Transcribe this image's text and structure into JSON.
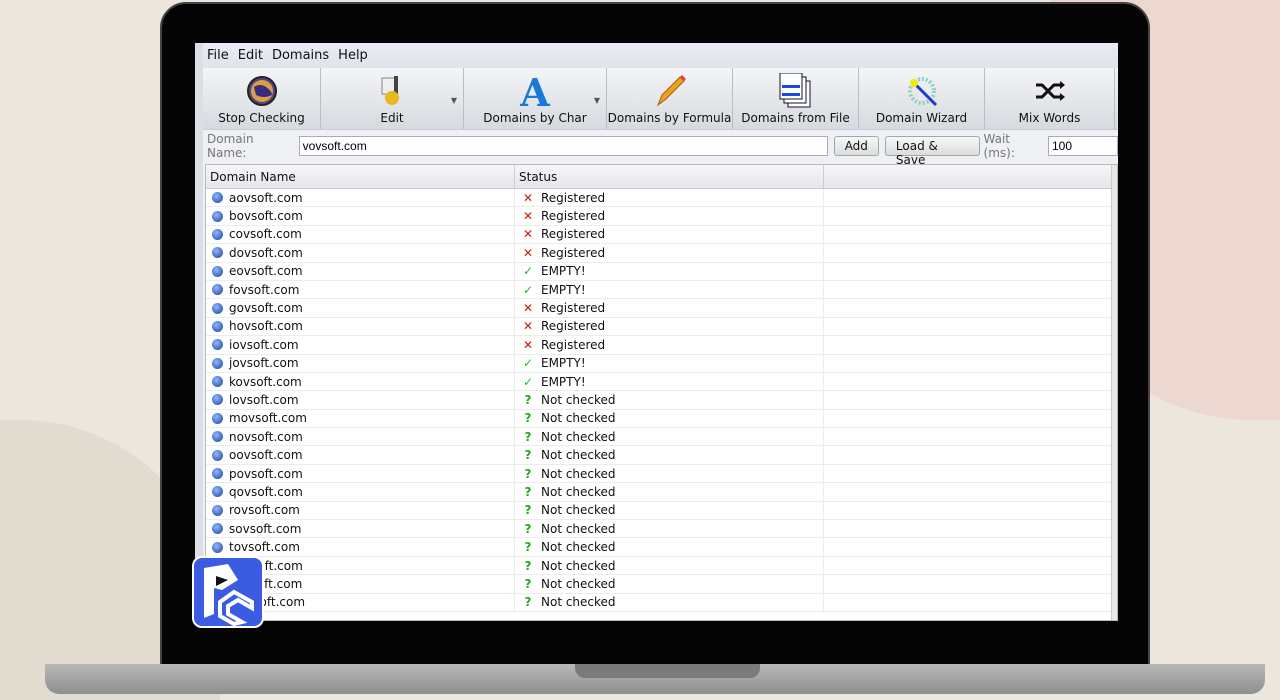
{
  "menu": [
    "File",
    "Edit",
    "Domains",
    "Help"
  ],
  "toolbar": [
    {
      "label": "Stop Checking",
      "icon": "stop-globe-icon",
      "dropdown": false,
      "width": 118
    },
    {
      "label": "Edit",
      "icon": "edit-gear-icon",
      "dropdown": true,
      "width": 143
    },
    {
      "label": "Domains by Char",
      "icon": "letter-a-icon",
      "dropdown": true,
      "width": 143
    },
    {
      "label": "Domains by Formula",
      "icon": "pencil-icon",
      "dropdown": false,
      "width": 126
    },
    {
      "label": "Domains from File",
      "icon": "documents-icon",
      "dropdown": false,
      "width": 126
    },
    {
      "label": "Domain Wizard",
      "icon": "magic-wand-icon",
      "dropdown": false,
      "width": 126
    },
    {
      "label": "Mix Words",
      "icon": "shuffle-icon",
      "dropdown": false,
      "width": 130
    }
  ],
  "input": {
    "label": "Domain Name:",
    "value": "vovsoft.com",
    "add": "Add",
    "load_save": "Load & Save",
    "wait_label": "Wait (ms):",
    "wait_value": "100"
  },
  "columns": [
    "Domain Name",
    "Status",
    ""
  ],
  "rows": [
    [
      "aovsoft.com",
      "x",
      "Registered"
    ],
    [
      "bovsoft.com",
      "x",
      "Registered"
    ],
    [
      "covsoft.com",
      "x",
      "Registered"
    ],
    [
      "dovsoft.com",
      "x",
      "Registered"
    ],
    [
      "eovsoft.com",
      "ok",
      "EMPTY!"
    ],
    [
      "fovsoft.com",
      "ok",
      "EMPTY!"
    ],
    [
      "govsoft.com",
      "x",
      "Registered"
    ],
    [
      "hovsoft.com",
      "x",
      "Registered"
    ],
    [
      "iovsoft.com",
      "x",
      "Registered"
    ],
    [
      "jovsoft.com",
      "ok",
      "EMPTY!"
    ],
    [
      "kovsoft.com",
      "ok",
      "EMPTY!"
    ],
    [
      "lovsoft.com",
      "q",
      "Not checked"
    ],
    [
      "movsoft.com",
      "q",
      "Not checked"
    ],
    [
      "novsoft.com",
      "q",
      "Not checked"
    ],
    [
      "oovsoft.com",
      "q",
      "Not checked"
    ],
    [
      "povsoft.com",
      "q",
      "Not checked"
    ],
    [
      "qovsoft.com",
      "q",
      "Not checked"
    ],
    [
      "rovsoft.com",
      "q",
      "Not checked"
    ],
    [
      "sovsoft.com",
      "q",
      "Not checked"
    ],
    [
      "tovsoft.com",
      "q",
      "Not checked"
    ],
    [
      "uovsoft.com",
      "q",
      "Not checked"
    ],
    [
      "vovsoft.com",
      "q",
      "Not checked"
    ],
    [
      "wovsoft.com",
      "q",
      "Not checked"
    ]
  ],
  "colors": {
    "x": "#e01010",
    "ok": "#22bb22",
    "q": "#22aa22"
  }
}
